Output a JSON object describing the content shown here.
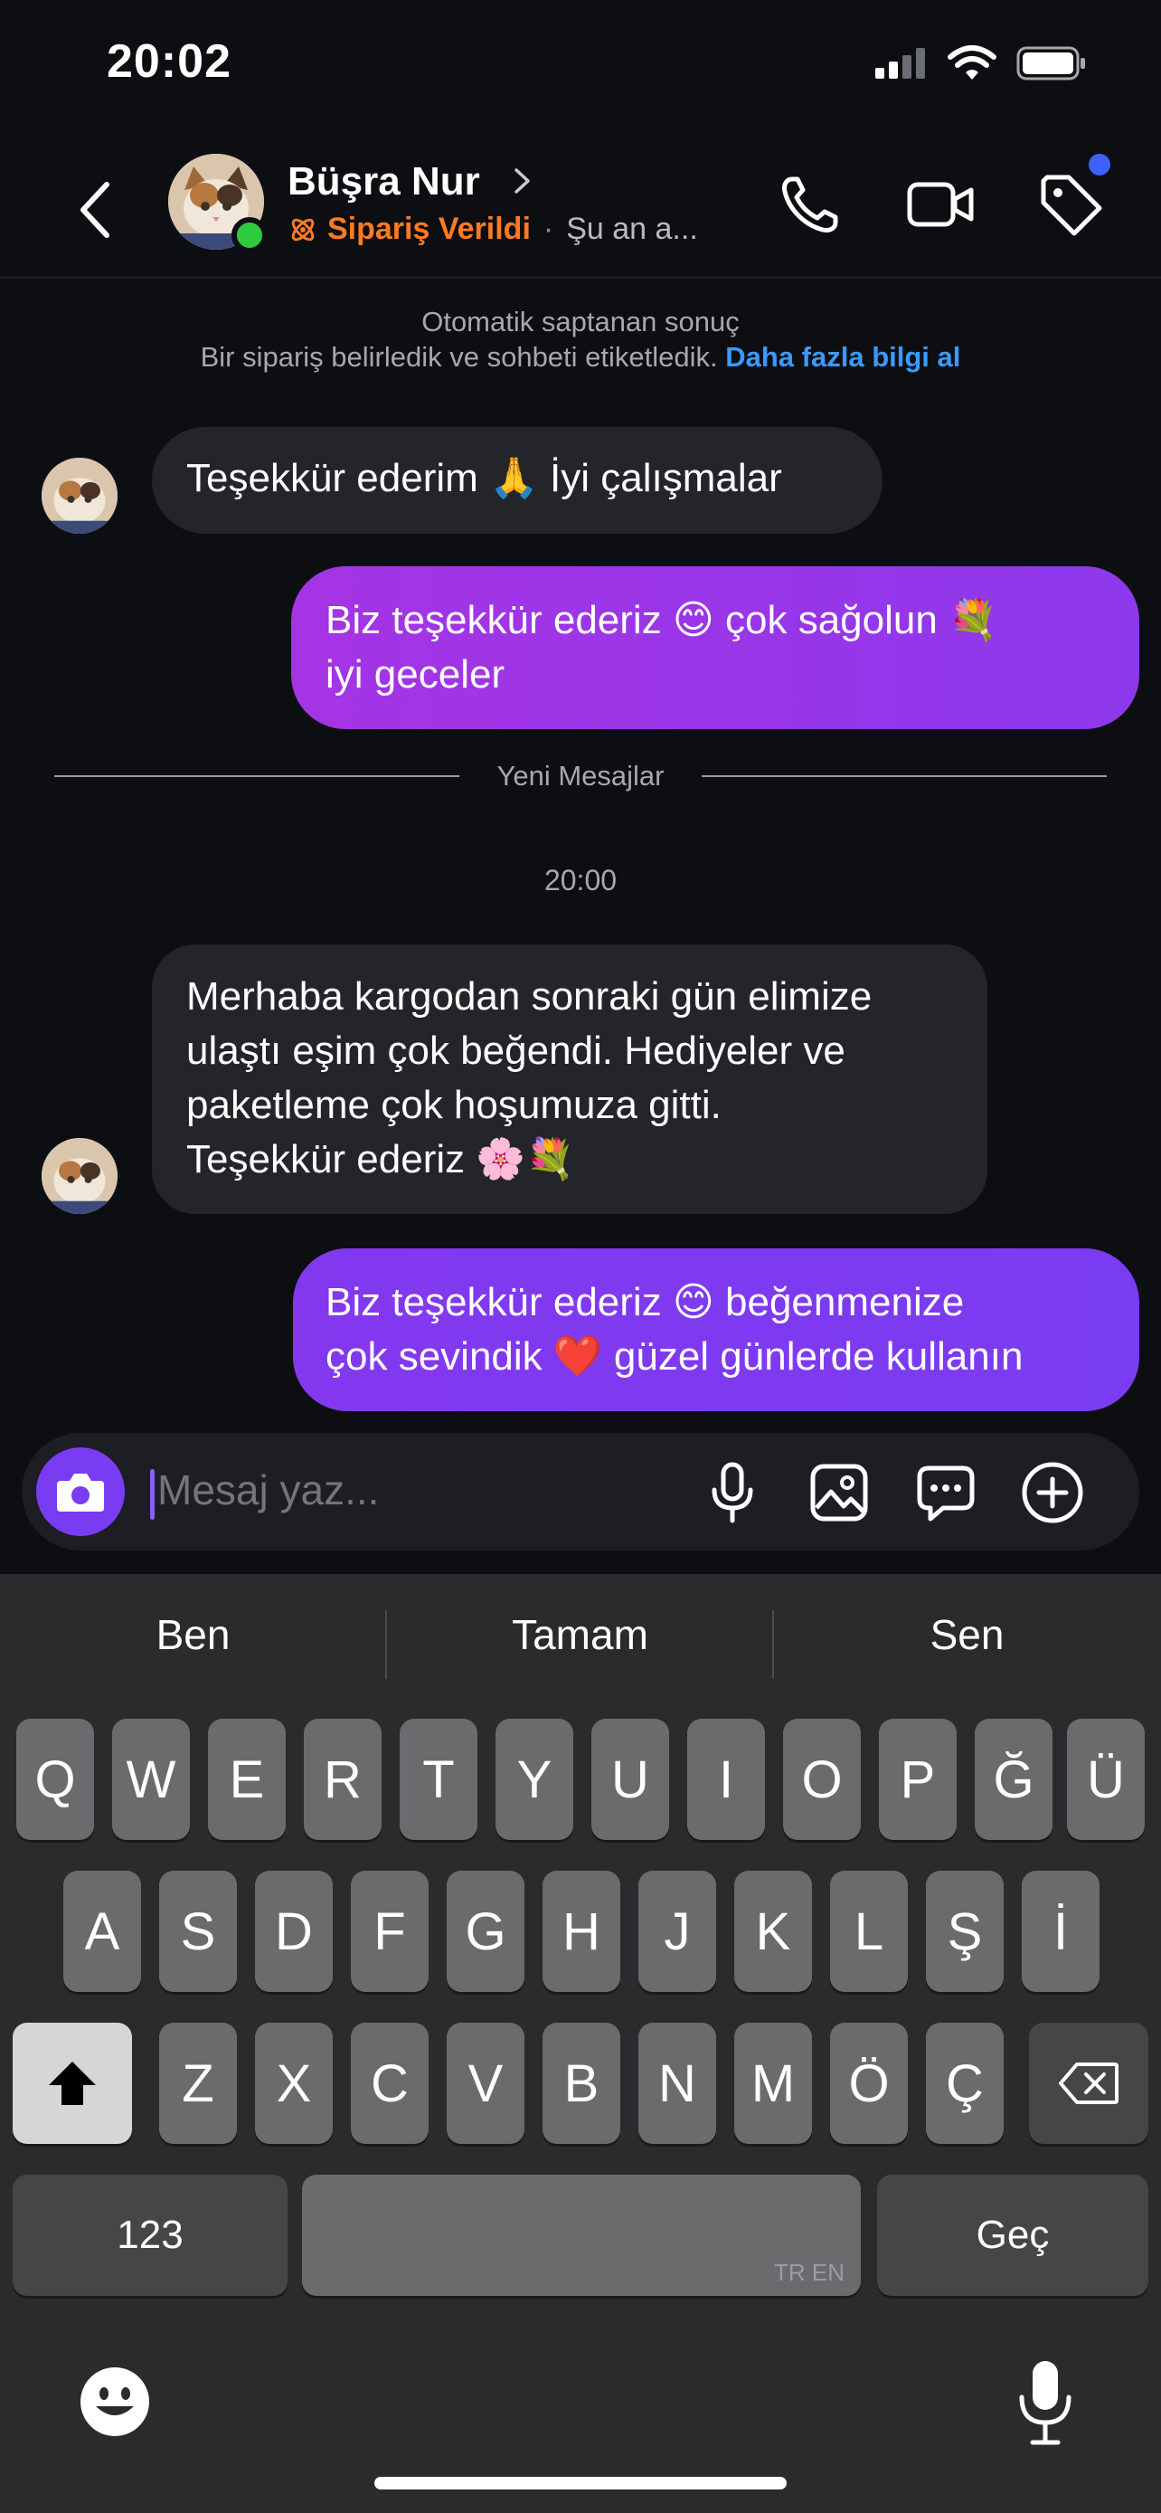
{
  "status": {
    "time": "20:02"
  },
  "header": {
    "name": "Büşra Nur",
    "order_status": "Sipariş Verildi",
    "presence": "Şu an a...",
    "colors": {
      "order": "#ff7a22",
      "online": "#2ecb3e",
      "badge": "#3d61ff"
    }
  },
  "info": {
    "line1": "Otomatik saptanan sonuç",
    "line2": "Bir sipariş belirledik ve sohbeti etiketledik.",
    "link": "Daha fazla bilgi al"
  },
  "messages": [
    {
      "dir": "in",
      "text": "Teşekkür ederim 🙏 İyi çalışmalar"
    },
    {
      "dir": "out",
      "line1": "Biz teşekkür ederiz 😊 çok sağolun 💐",
      "line2": "iyi geceler"
    },
    {
      "dir": "in",
      "line1": "Merhaba kargodan sonraki gün elimize",
      "line2": "ulaştı eşim çok beğendi. Hediyeler ve",
      "line3": "paketleme çok hoşumuza gitti.",
      "line4": "Teşekkür ederiz 🌸💐"
    },
    {
      "dir": "out",
      "line1": "Biz teşekkür ederiz 😊 beğenmenize",
      "line2": "çok sevindik ❤️ güzel günlerde kullanın"
    }
  ],
  "divider": {
    "label": "Yeni Mesajlar"
  },
  "time_label": "20:00",
  "composer": {
    "placeholder": "Mesaj yaz..."
  },
  "keyboard": {
    "suggestions": [
      "Ben",
      "Tamam",
      "Sen"
    ],
    "row1": [
      "Q",
      "W",
      "E",
      "R",
      "T",
      "Y",
      "U",
      "I",
      "O",
      "P",
      "Ğ",
      "Ü"
    ],
    "row2": [
      "A",
      "S",
      "D",
      "F",
      "G",
      "H",
      "J",
      "K",
      "L",
      "Ş",
      "İ"
    ],
    "row3": [
      "Z",
      "X",
      "C",
      "V",
      "B",
      "N",
      "M",
      "Ö",
      "Ç"
    ],
    "numbers_key": "123",
    "space_lang": "TR EN",
    "return_key": "Geç"
  },
  "colors": {
    "outgoing_1": "#9a35e6",
    "outgoing_2": "#7b3bf0",
    "incoming": "#23252b",
    "link": "#3b9aff"
  }
}
